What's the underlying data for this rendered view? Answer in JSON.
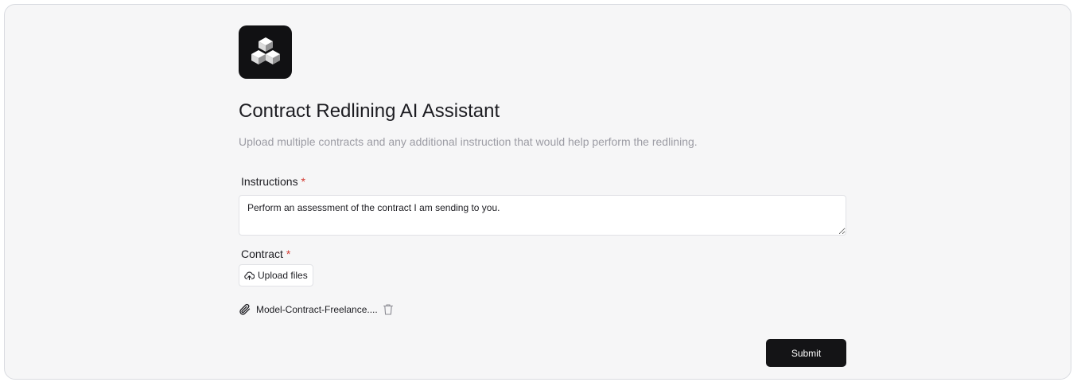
{
  "app": {
    "logo_icon": "cubes-logo-icon",
    "title": "Contract Redlining AI Assistant",
    "subtitle": "Upload multiple contracts and any additional instruction that would help perform the redlining."
  },
  "form": {
    "instructions": {
      "label": "Instructions",
      "required_marker": "*",
      "value": "Perform an assessment of the contract I am sending to you."
    },
    "contract": {
      "label": "Contract",
      "required_marker": "*",
      "upload_label": "Upload files",
      "upload_icon": "cloud-upload-icon",
      "files": [
        {
          "name": "Model-Contract-Freelance....",
          "icon": "paperclip-icon",
          "delete_icon": "trash-icon"
        }
      ]
    },
    "submit_label": "Submit"
  },
  "colors": {
    "background": "#f6f6f7",
    "primary_button": "#141416",
    "required": "#d33a32",
    "subtitle": "#9c9ca4"
  }
}
